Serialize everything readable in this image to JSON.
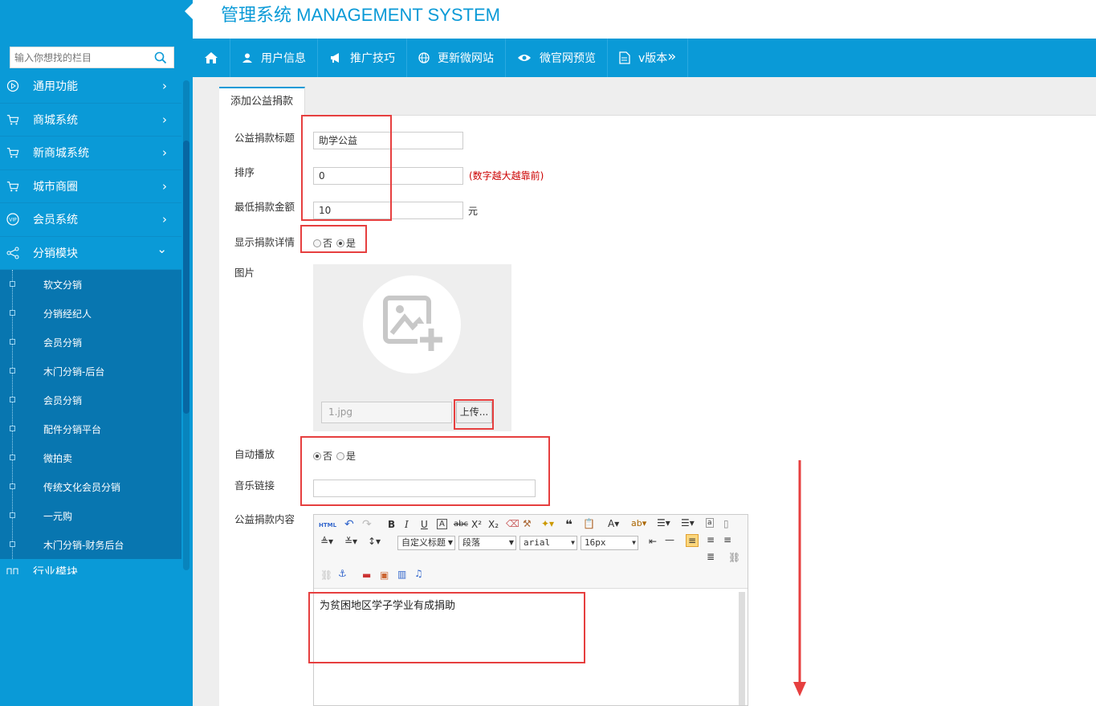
{
  "header": {
    "title": "管理系统 MANAGEMENT SYSTEM"
  },
  "sidebar": {
    "search_placeholder": "输入你想找的栏目",
    "menu": [
      {
        "label": "通用功能",
        "icon": "play-circle-icon",
        "arrow": "›"
      },
      {
        "label": "商城系统",
        "icon": "cart-icon",
        "arrow": "›"
      },
      {
        "label": "新商城系统",
        "icon": "cart-icon",
        "arrow": "›"
      },
      {
        "label": "城市商圈",
        "icon": "cart-icon",
        "arrow": "›"
      },
      {
        "label": "会员系统",
        "icon": "vip-icon",
        "arrow": "›"
      },
      {
        "label": "分销模块",
        "icon": "share-icon",
        "arrow": "⌄"
      }
    ],
    "submenu": [
      "软文分销",
      "分销经纪人",
      "会员分销",
      "木门分销-后台",
      "会员分销",
      "配件分销平台",
      "微拍卖",
      "传统文化会员分销",
      "一元购",
      "木门分销-财务后台"
    ],
    "partial_item": "行业模块"
  },
  "topnav": {
    "items": [
      {
        "label": "",
        "icon": "home-icon"
      },
      {
        "label": "用户信息",
        "icon": "user-icon"
      },
      {
        "label": "推广技巧",
        "icon": "megaphone-icon"
      },
      {
        "label": "更新微网站",
        "icon": "globe-icon"
      },
      {
        "label": "微官网预览",
        "icon": "eye-icon"
      },
      {
        "label": "v版本",
        "icon": "doc-icon",
        "suffix": "»"
      }
    ]
  },
  "tab": {
    "label": "添加公益捐款"
  },
  "form": {
    "title_label": "公益捐款标题",
    "title_value": "助学公益",
    "sort_label": "排序",
    "sort_value": "0",
    "sort_hint": "(数字越大越靠前)",
    "min_label": "最低捐款金额",
    "min_value": "10",
    "min_unit": "元",
    "show_label": "显示捐款详情",
    "show_opt_no": "否",
    "show_opt_yes": "是",
    "show_selected": "是",
    "image_label": "图片",
    "image_file": "1.jpg",
    "upload_button": "上传...",
    "autoplay_label": "自动播放",
    "autoplay_opt_no": "否",
    "autoplay_opt_yes": "是",
    "autoplay_selected": "否",
    "music_label": "音乐链接",
    "music_value": "",
    "content_label": "公益捐款内容",
    "content_text": "为贫困地区学子学业有成捐助"
  },
  "editor": {
    "html_btn": "HTML",
    "style_select": "自定义标题",
    "para_select": "段落",
    "font_select": "arial",
    "size_select": "16px"
  },
  "colors": {
    "accent": "#0a9ad7",
    "annotation": "#e63f3f",
    "hint": "#cc0000"
  }
}
